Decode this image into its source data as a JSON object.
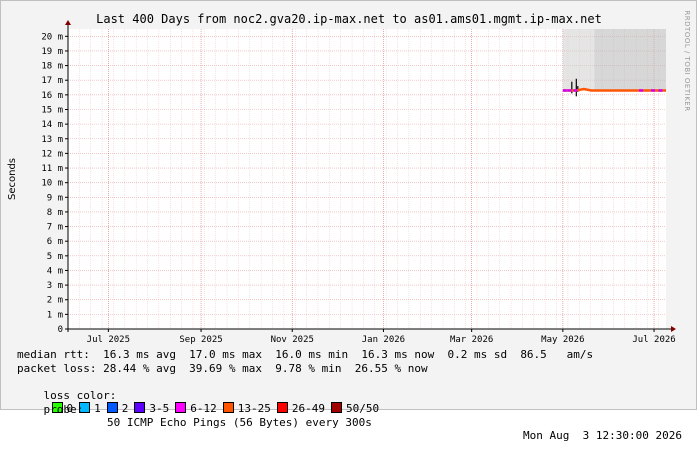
{
  "chart_data": {
    "type": "line",
    "title": "Last 400 Days from noc2.gva20.ip-max.net to as01.ams01.mgmt.ip-max.net",
    "ylabel": "Seconds",
    "watermark": "RRDTOOL / TOBI OETIKER",
    "ylim": [
      0,
      20.5
    ],
    "yticks": [
      {
        "v": 0,
        "label": "0"
      },
      {
        "v": 1,
        "label": "1 m"
      },
      {
        "v": 2,
        "label": "2 m"
      },
      {
        "v": 3,
        "label": "3 m"
      },
      {
        "v": 4,
        "label": "4 m"
      },
      {
        "v": 5,
        "label": "5 m"
      },
      {
        "v": 6,
        "label": "6 m"
      },
      {
        "v": 7,
        "label": "7 m"
      },
      {
        "v": 8,
        "label": "8 m"
      },
      {
        "v": 9,
        "label": "9 m"
      },
      {
        "v": 10,
        "label": "10 m"
      },
      {
        "v": 11,
        "label": "11 m"
      },
      {
        "v": 12,
        "label": "12 m"
      },
      {
        "v": 13,
        "label": "13 m"
      },
      {
        "v": 14,
        "label": "14 m"
      },
      {
        "v": 15,
        "label": "15 m"
      },
      {
        "v": 16,
        "label": "16 m"
      },
      {
        "v": 17,
        "label": "17 m"
      },
      {
        "v": 18,
        "label": "18 m"
      },
      {
        "v": 19,
        "label": "19 m"
      },
      {
        "v": 20,
        "label": "20 m"
      }
    ],
    "xlim": [
      0,
      400
    ],
    "xticks": [
      {
        "v": 27,
        "label": "Jul 2025"
      },
      {
        "v": 89,
        "label": "Sep 2025"
      },
      {
        "v": 150,
        "label": "Nov 2025"
      },
      {
        "v": 211,
        "label": "Jan 2026"
      },
      {
        "v": 270,
        "label": "Mar 2026"
      },
      {
        "v": 331,
        "label": "May 2026"
      },
      {
        "v": 392,
        "label": "Jul 2026"
      }
    ],
    "series": [
      {
        "name": "median rtt",
        "color": "#ff5500",
        "x": [
          331,
          340,
          345,
          350,
          360,
          370,
          380,
          390,
          400
        ],
        "y": [
          16.3,
          16.3,
          16.4,
          16.3,
          16.3,
          16.3,
          16.3,
          16.3,
          16.3
        ]
      }
    ],
    "smoke": {
      "start": 331,
      "end": 400,
      "dense_from": 352,
      "top": 20.5,
      "bottom": 16.3,
      "color": "#d0d0d0",
      "dense_color": "#bdbdbd"
    },
    "loss_marks": {
      "color": "#cc00ff",
      "x": [
        331,
        334,
        338,
        382,
        390,
        395
      ],
      "y": [
        16.3,
        16.3,
        16.3,
        16.3,
        16.3,
        16.3
      ]
    },
    "spikes": [
      {
        "x": 337,
        "y0": 16.1,
        "y1": 16.9
      },
      {
        "x": 340,
        "y0": 15.9,
        "y1": 17.1
      },
      {
        "x": 341,
        "y0": 16.2,
        "y1": 16.6
      }
    ],
    "grid": true
  },
  "stats": {
    "median_rtt": "median rtt:  16.3 ms avg  17.0 ms max  16.0 ms min  16.3 ms now  0.2 ms sd  86.5   am/s",
    "packet_loss": "packet loss: 28.44 % avg  39.69 % max  9.78 % min  26.55 % now",
    "loss_color_label": "loss color:",
    "loss_colors": [
      {
        "label": "0",
        "color": "#26ff00"
      },
      {
        "label": "1",
        "color": "#00b8ff"
      },
      {
        "label": "2",
        "color": "#0059ff"
      },
      {
        "label": "3-5",
        "color": "#5e00ff"
      },
      {
        "label": "6-12",
        "color": "#ff00ff"
      },
      {
        "label": "13-25",
        "color": "#ff5500"
      },
      {
        "label": "26-49",
        "color": "#ff0000"
      },
      {
        "label": "50/50",
        "color": "#a10000"
      }
    ],
    "probe_label": "probe:",
    "probe_text": "50 ICMP Echo Pings (56 Bytes) every 300s",
    "timestamp": "Mon Aug  3 12:30:00 2026"
  }
}
